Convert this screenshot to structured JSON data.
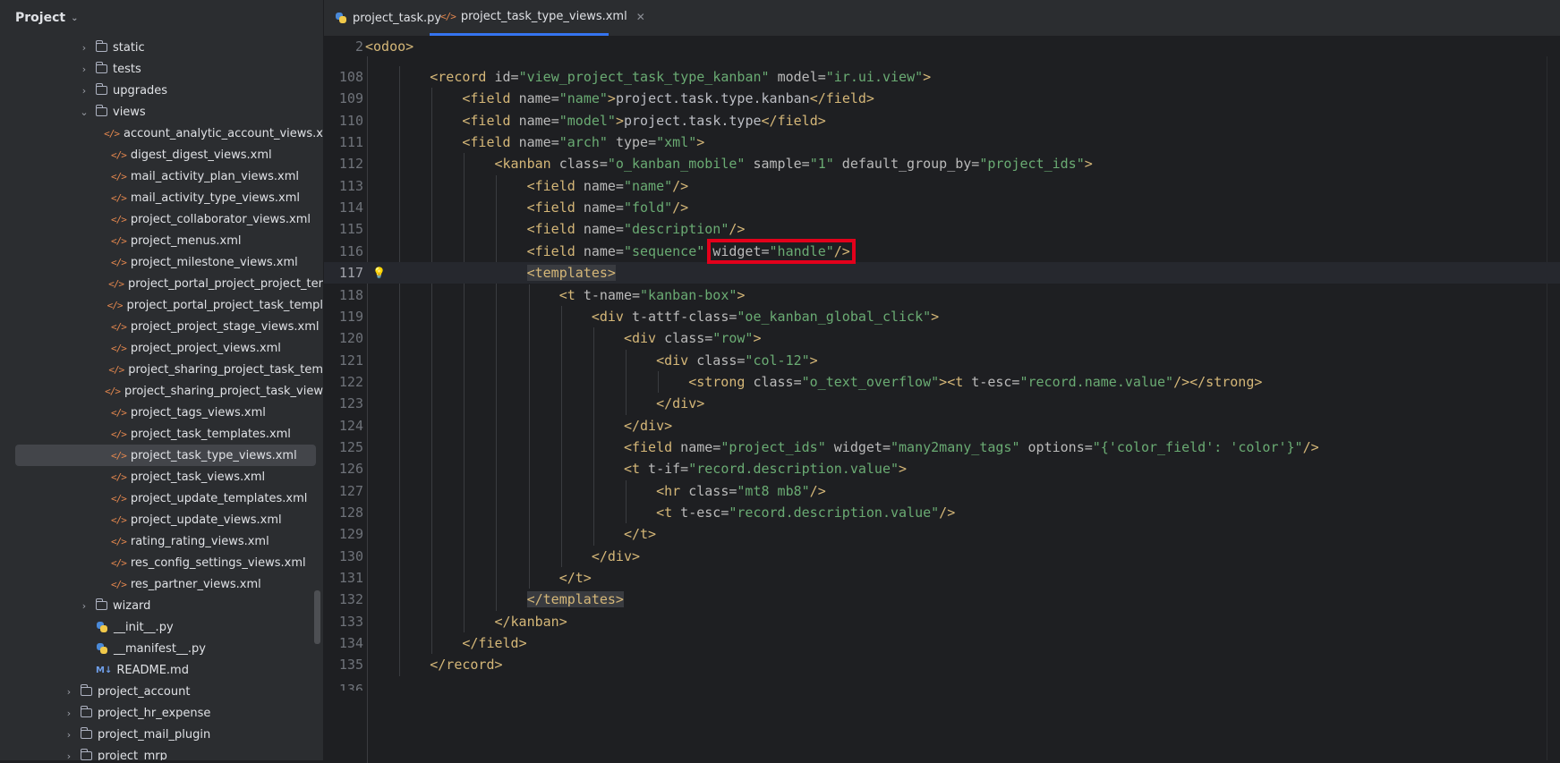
{
  "sidebar": {
    "title": "Project",
    "items": [
      {
        "label": "static",
        "kind": "folder",
        "indent": 1,
        "arrow": "›"
      },
      {
        "label": "tests",
        "kind": "folder",
        "indent": 1,
        "arrow": "›"
      },
      {
        "label": "upgrades",
        "kind": "folder",
        "indent": 1,
        "arrow": "›"
      },
      {
        "label": "views",
        "kind": "folder",
        "indent": 1,
        "arrow": "⌄"
      },
      {
        "label": "account_analytic_account_views.x",
        "kind": "xml",
        "indent": 2
      },
      {
        "label": "digest_digest_views.xml",
        "kind": "xml",
        "indent": 2
      },
      {
        "label": "mail_activity_plan_views.xml",
        "kind": "xml",
        "indent": 2
      },
      {
        "label": "mail_activity_type_views.xml",
        "kind": "xml",
        "indent": 2
      },
      {
        "label": "project_collaborator_views.xml",
        "kind": "xml",
        "indent": 2
      },
      {
        "label": "project_menus.xml",
        "kind": "xml",
        "indent": 2
      },
      {
        "label": "project_milestone_views.xml",
        "kind": "xml",
        "indent": 2
      },
      {
        "label": "project_portal_project_project_ter",
        "kind": "xml",
        "indent": 2
      },
      {
        "label": "project_portal_project_task_templ",
        "kind": "xml",
        "indent": 2
      },
      {
        "label": "project_project_stage_views.xml",
        "kind": "xml",
        "indent": 2
      },
      {
        "label": "project_project_views.xml",
        "kind": "xml",
        "indent": 2
      },
      {
        "label": "project_sharing_project_task_tem",
        "kind": "xml",
        "indent": 2
      },
      {
        "label": "project_sharing_project_task_view",
        "kind": "xml",
        "indent": 2
      },
      {
        "label": "project_tags_views.xml",
        "kind": "xml",
        "indent": 2
      },
      {
        "label": "project_task_templates.xml",
        "kind": "xml",
        "indent": 2
      },
      {
        "label": "project_task_type_views.xml",
        "kind": "xml",
        "indent": 2,
        "selected": true
      },
      {
        "label": "project_task_views.xml",
        "kind": "xml",
        "indent": 2
      },
      {
        "label": "project_update_templates.xml",
        "kind": "xml",
        "indent": 2
      },
      {
        "label": "project_update_views.xml",
        "kind": "xml",
        "indent": 2
      },
      {
        "label": "rating_rating_views.xml",
        "kind": "xml",
        "indent": 2
      },
      {
        "label": "res_config_settings_views.xml",
        "kind": "xml",
        "indent": 2
      },
      {
        "label": "res_partner_views.xml",
        "kind": "xml",
        "indent": 2
      },
      {
        "label": "wizard",
        "kind": "folder",
        "indent": 1,
        "arrow": "›"
      },
      {
        "label": "__init__.py",
        "kind": "py",
        "indent": 1
      },
      {
        "label": "__manifest__.py",
        "kind": "py",
        "indent": 1
      },
      {
        "label": "README.md",
        "kind": "md",
        "indent": 1
      },
      {
        "label": "project_account",
        "kind": "folder",
        "indent": 0,
        "arrow": "›"
      },
      {
        "label": "project_hr_expense",
        "kind": "folder",
        "indent": 0,
        "arrow": "›"
      },
      {
        "label": "project_mail_plugin",
        "kind": "folder",
        "indent": 0,
        "arrow": "›"
      },
      {
        "label": "project_mrp",
        "kind": "folder",
        "indent": 0,
        "arrow": "›"
      }
    ]
  },
  "tabs": [
    {
      "label": "project_task.py",
      "kind": "py"
    },
    {
      "label": "project_task_type_views.xml",
      "kind": "xml",
      "active": true
    }
  ],
  "editor": {
    "inspection_count": "2",
    "sticky": {
      "num": "2",
      "code": [
        [
          "t",
          "<odoo>"
        ]
      ]
    },
    "partial_top_num": "107",
    "partial_bottom_num": "136",
    "lines": [
      {
        "num": "108",
        "indent": 2,
        "code": [
          [
            "t",
            "<record "
          ],
          [
            "a",
            "id="
          ],
          [
            "v",
            "\"view_project_task_type_kanban\""
          ],
          [
            "a",
            " model="
          ],
          [
            "v",
            "\"ir.ui.view\""
          ],
          [
            "t",
            ">"
          ]
        ]
      },
      {
        "num": "109",
        "indent": 3,
        "code": [
          [
            "t",
            "<field "
          ],
          [
            "a",
            "name="
          ],
          [
            "v",
            "\"name\""
          ],
          [
            "t",
            ">"
          ],
          [
            "tx",
            "project.task.type.kanban"
          ],
          [
            "t",
            "</field>"
          ]
        ]
      },
      {
        "num": "110",
        "indent": 3,
        "code": [
          [
            "t",
            "<field "
          ],
          [
            "a",
            "name="
          ],
          [
            "v",
            "\"model\""
          ],
          [
            "t",
            ">"
          ],
          [
            "tx",
            "project.task.type"
          ],
          [
            "t",
            "</field>"
          ]
        ]
      },
      {
        "num": "111",
        "indent": 3,
        "code": [
          [
            "t",
            "<field "
          ],
          [
            "a",
            "name="
          ],
          [
            "v",
            "\"arch\""
          ],
          [
            "a",
            " type="
          ],
          [
            "v",
            "\"xml\""
          ],
          [
            "t",
            ">"
          ]
        ]
      },
      {
        "num": "112",
        "indent": 4,
        "code": [
          [
            "t",
            "<kanban "
          ],
          [
            "a",
            "class="
          ],
          [
            "v",
            "\"o_kanban_mobile\""
          ],
          [
            "a",
            " sample="
          ],
          [
            "v",
            "\"1\""
          ],
          [
            "a",
            " default_group_by="
          ],
          [
            "v",
            "\"project_ids\""
          ],
          [
            "t",
            ">"
          ]
        ]
      },
      {
        "num": "113",
        "indent": 5,
        "code": [
          [
            "t",
            "<field "
          ],
          [
            "a",
            "name="
          ],
          [
            "v",
            "\"name\""
          ],
          [
            "t",
            "/>"
          ]
        ]
      },
      {
        "num": "114",
        "indent": 5,
        "code": [
          [
            "t",
            "<field "
          ],
          [
            "a",
            "name="
          ],
          [
            "v",
            "\"fold\""
          ],
          [
            "t",
            "/>"
          ]
        ]
      },
      {
        "num": "115",
        "indent": 5,
        "code": [
          [
            "t",
            "<field "
          ],
          [
            "a",
            "name="
          ],
          [
            "v",
            "\"description\""
          ],
          [
            "t",
            "/>"
          ]
        ]
      },
      {
        "num": "116",
        "indent": 5,
        "code": [
          [
            "t",
            "<field "
          ],
          [
            "a",
            "name="
          ],
          [
            "v",
            "\"sequence\""
          ],
          [
            "a",
            " widget="
          ],
          [
            "v",
            "\"handle\""
          ],
          [
            "t",
            "/>"
          ]
        ]
      },
      {
        "num": "117",
        "indent": 5,
        "current": true,
        "bulb": true,
        "code": [
          [
            "th",
            "<templates>"
          ]
        ]
      },
      {
        "num": "118",
        "indent": 6,
        "code": [
          [
            "t",
            "<t "
          ],
          [
            "a",
            "t-name="
          ],
          [
            "v",
            "\"kanban-box\""
          ],
          [
            "t",
            ">"
          ]
        ]
      },
      {
        "num": "119",
        "indent": 7,
        "code": [
          [
            "t",
            "<div "
          ],
          [
            "a",
            "t-attf-class="
          ],
          [
            "v",
            "\"oe_kanban_global_click\""
          ],
          [
            "t",
            ">"
          ]
        ]
      },
      {
        "num": "120",
        "indent": 8,
        "code": [
          [
            "t",
            "<div "
          ],
          [
            "a",
            "class="
          ],
          [
            "v",
            "\"row\""
          ],
          [
            "t",
            ">"
          ]
        ]
      },
      {
        "num": "121",
        "indent": 9,
        "code": [
          [
            "t",
            "<div "
          ],
          [
            "a",
            "class="
          ],
          [
            "v",
            "\"col-12\""
          ],
          [
            "t",
            ">"
          ]
        ]
      },
      {
        "num": "122",
        "indent": 10,
        "code": [
          [
            "t",
            "<strong "
          ],
          [
            "a",
            "class="
          ],
          [
            "v",
            "\"o_text_overflow\""
          ],
          [
            "t",
            ">"
          ],
          [
            "t",
            "<t "
          ],
          [
            "a",
            "t-esc="
          ],
          [
            "v",
            "\"record.name.value\""
          ],
          [
            "t",
            "/>"
          ],
          [
            "t",
            "</strong>"
          ]
        ]
      },
      {
        "num": "123",
        "indent": 9,
        "code": [
          [
            "t",
            "</div>"
          ]
        ]
      },
      {
        "num": "124",
        "indent": 8,
        "code": [
          [
            "t",
            "</div>"
          ]
        ]
      },
      {
        "num": "125",
        "indent": 8,
        "code": [
          [
            "t",
            "<field "
          ],
          [
            "a",
            "name="
          ],
          [
            "v",
            "\"project_ids\""
          ],
          [
            "a",
            " widget="
          ],
          [
            "v",
            "\"many2many_tags\""
          ],
          [
            "a",
            " options="
          ],
          [
            "v",
            "\"{'color_field': 'color'}\""
          ],
          [
            "t",
            "/>"
          ]
        ]
      },
      {
        "num": "126",
        "indent": 8,
        "code": [
          [
            "t",
            "<t "
          ],
          [
            "a",
            "t-if="
          ],
          [
            "v",
            "\"record.description.value\""
          ],
          [
            "t",
            ">"
          ]
        ]
      },
      {
        "num": "127",
        "indent": 9,
        "code": [
          [
            "t",
            "<hr "
          ],
          [
            "a",
            "class="
          ],
          [
            "v",
            "\"mt8 mb8\""
          ],
          [
            "t",
            "/>"
          ]
        ]
      },
      {
        "num": "128",
        "indent": 9,
        "code": [
          [
            "t",
            "<t "
          ],
          [
            "a",
            "t-esc="
          ],
          [
            "v",
            "\"record.description.value\""
          ],
          [
            "t",
            "/>"
          ]
        ]
      },
      {
        "num": "129",
        "indent": 8,
        "code": [
          [
            "t",
            "</t>"
          ]
        ]
      },
      {
        "num": "130",
        "indent": 7,
        "code": [
          [
            "t",
            "</div>"
          ]
        ]
      },
      {
        "num": "131",
        "indent": 6,
        "code": [
          [
            "t",
            "</t>"
          ]
        ]
      },
      {
        "num": "132",
        "indent": 5,
        "code": [
          [
            "th",
            "</templates>"
          ]
        ]
      },
      {
        "num": "133",
        "indent": 4,
        "code": [
          [
            "t",
            "</kanban>"
          ]
        ]
      },
      {
        "num": "134",
        "indent": 3,
        "code": [
          [
            "t",
            "</field>"
          ]
        ]
      },
      {
        "num": "135",
        "indent": 2,
        "code": [
          [
            "t",
            "</record>"
          ]
        ]
      }
    ]
  }
}
